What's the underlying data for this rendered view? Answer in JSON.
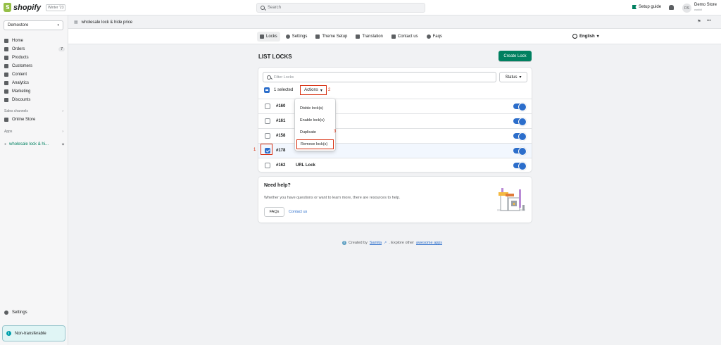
{
  "topbar": {
    "logo": "shopify",
    "edition": "Winter '23",
    "search_placeholder": "Search",
    "setup_guide": "Setup guide",
    "avatar_initials": "DS",
    "store_name": "Demo Store",
    "store_sub": "csddd"
  },
  "sidebar": {
    "store_select": "Demostore",
    "items": [
      {
        "label": "Home"
      },
      {
        "label": "Orders",
        "badge": "7"
      },
      {
        "label": "Products"
      },
      {
        "label": "Customers"
      },
      {
        "label": "Content"
      },
      {
        "label": "Analytics"
      },
      {
        "label": "Marketing"
      },
      {
        "label": "Discounts"
      }
    ],
    "sales_channels_heading": "Sales channels",
    "online_store": "Online Store",
    "apps_heading": "Apps",
    "app_item": "wholesale lock & hi...",
    "settings": "Settings",
    "non_transferable": "Non-transferable"
  },
  "app_header": {
    "title": "wholesale lock & hide price",
    "pin": "⚑",
    "more": "•••"
  },
  "tabs": [
    {
      "label": "Locks",
      "icon": "lock-icon"
    },
    {
      "label": "Settings",
      "icon": "gear-icon"
    },
    {
      "label": "Theme Setup",
      "icon": "layout-icon"
    },
    {
      "label": "Translation",
      "icon": "translate-icon"
    },
    {
      "label": "Contact us",
      "icon": "mail-icon"
    },
    {
      "label": "Faqs",
      "icon": "question-icon"
    }
  ],
  "language": "English",
  "page": {
    "title": "LIST LOCKS",
    "create_button": "Create Lock",
    "filter_placeholder": "Filter Locks",
    "status_button": "Status",
    "selected_text": "1 selected",
    "actions_button": "Actions"
  },
  "rows": [
    {
      "id": "#160",
      "name": "",
      "checked": false
    },
    {
      "id": "#161",
      "name": "",
      "checked": false
    },
    {
      "id": "#158",
      "name": "",
      "checked": false
    },
    {
      "id": "#178",
      "name": "",
      "checked": true
    },
    {
      "id": "#162",
      "name": "URL Lock",
      "checked": false
    }
  ],
  "menu": [
    "Disble lock(s)",
    "Enable lock(s)",
    "Duplicate",
    "Remove lock(s)"
  ],
  "annotations": {
    "one": "1",
    "two": "2",
    "three": "3"
  },
  "help": {
    "title": "Need help?",
    "text": "Whether you have questions or want to learn more, there are resources to help.",
    "faqs_button": "FAQs",
    "contact_link": "Contact us"
  },
  "footer": {
    "prefix": "Created by",
    "samita": "Samita",
    "middle": ". Explore other",
    "apps_link": "awesome apps"
  },
  "colors": {
    "accent": "#008060",
    "annotation": "#d72c0d",
    "link": "#2c6ecb"
  }
}
